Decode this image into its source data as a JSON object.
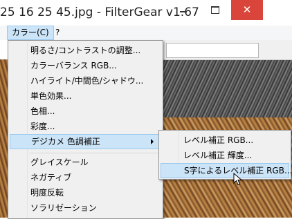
{
  "window": {
    "title": "25 16 25 45.jpg - FilterGear v1.67",
    "close_glyph": "✕"
  },
  "menubar": {
    "items": [
      {
        "label": "カラー(C)",
        "active": true
      },
      {
        "label": "?"
      }
    ]
  },
  "color_menu": {
    "items": [
      {
        "label": "明るさ/コントラストの調整..."
      },
      {
        "label": "カラーバランス RGB..."
      },
      {
        "label": "ハイライト/中間色/シャドウ..."
      },
      {
        "label": "単色効果..."
      },
      {
        "label": "色相..."
      },
      {
        "label": "彩度..."
      },
      {
        "label": "デジカメ 色調補正",
        "has_submenu": true,
        "active": true
      },
      {
        "label": "グレイスケール"
      },
      {
        "label": "ネガティブ"
      },
      {
        "label": "明度反転"
      },
      {
        "label": "ソラリゼーション"
      }
    ]
  },
  "submenu": {
    "items": [
      {
        "label": "レベル補正 RGB..."
      },
      {
        "label": "レベル補正 輝度..."
      },
      {
        "label": "S字によるレベル補正 RGB...",
        "active": true
      }
    ]
  },
  "colors": {
    "highlight": "#cce4f7",
    "highlight_border": "#99c9ef",
    "close_button": "#d9453a",
    "menu_bg": "#f0f0f0"
  },
  "icons": {
    "pointer": "arrow-cursor"
  }
}
